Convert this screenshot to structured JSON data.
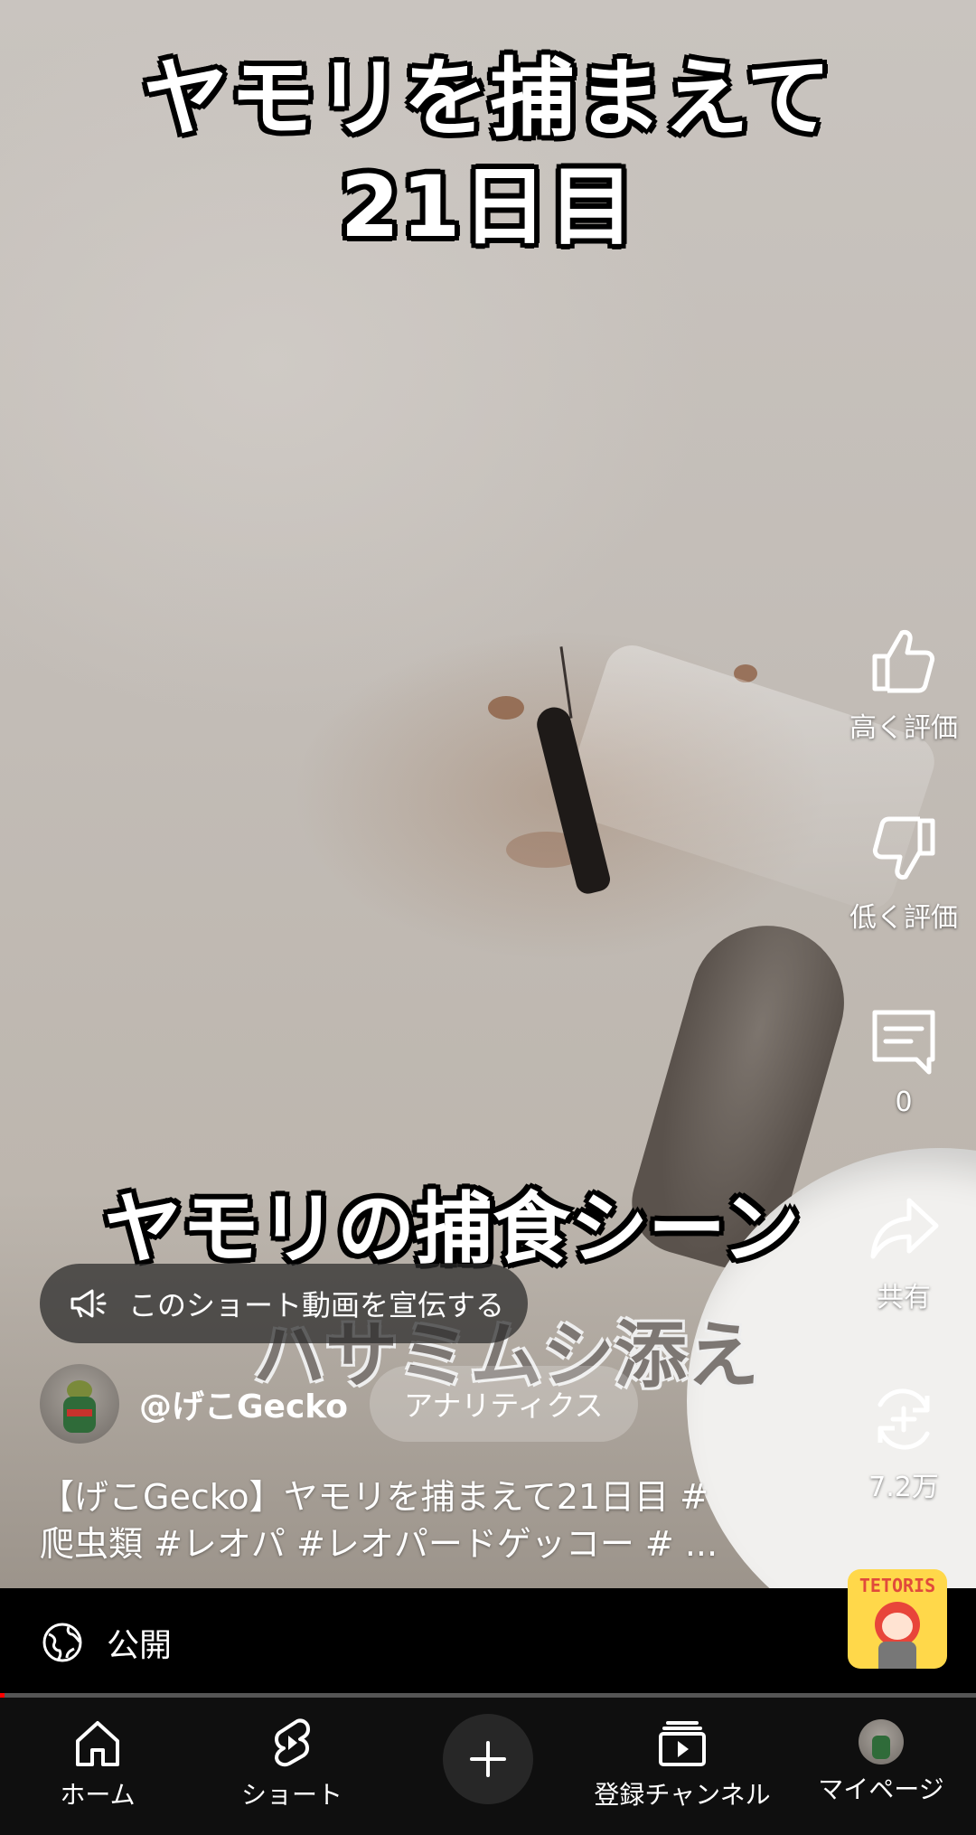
{
  "video": {
    "overlay_title_line1": "ヤモリを捕まえて",
    "overlay_title_line2": "21日目",
    "overlay_sub_line1": "ヤモリの捕食シーン",
    "overlay_sub_line2": "ハサミムシ添え"
  },
  "promo": {
    "label": "このショート動画を宣伝する",
    "icon": "megaphone-icon"
  },
  "channel": {
    "handle": "@げこGecko",
    "analytics_label": "アナリティクス"
  },
  "caption": {
    "line1": "【げこGecko】ヤモリを捕まえて21日目 #",
    "line2": "爬虫類 #レオパ #レオパードゲッコー # ..."
  },
  "actions": {
    "like_label": "高く評価",
    "dislike_label": "低く評価",
    "comments_count": "0",
    "share_label": "共有",
    "remix_count": "7.2万"
  },
  "visibility": {
    "label": "公開",
    "icon": "globe-icon"
  },
  "badge": {
    "text": "TETORIS"
  },
  "progress": {
    "fraction": 0.005
  },
  "nav": {
    "home": "ホーム",
    "shorts": "ショート",
    "create_icon": "plus-icon",
    "subscriptions": "登録チャンネル",
    "you": "マイページ"
  },
  "colors": {
    "accent": "#ff0000",
    "nav_bg": "#0f0f0f",
    "badge_bg": "#ffd84a"
  }
}
